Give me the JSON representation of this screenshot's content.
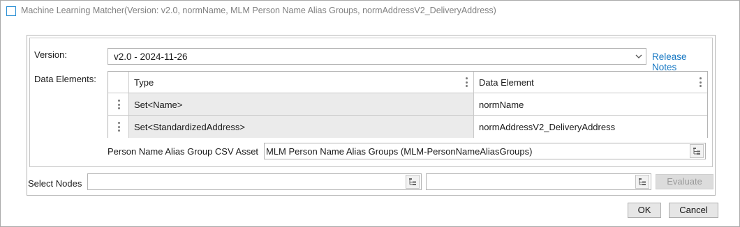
{
  "window": {
    "title": "Machine Learning Matcher(Version: v2.0, normName, MLM Person Name Alias Groups, normAddressV2_DeliveryAddress)"
  },
  "version": {
    "label": "Version:",
    "value": "v2.0 - 2024-11-26",
    "release_notes_label": "Release Notes"
  },
  "data_elements": {
    "label": "Data Elements:",
    "columns": [
      "Type",
      "Data Element"
    ],
    "rows": [
      {
        "type": "Set<Name>",
        "data_element": "normName"
      },
      {
        "type": "Set<StandardizedAddress>",
        "data_element": "normAddressV2_DeliveryAddress"
      }
    ]
  },
  "asset": {
    "label": "Person Name Alias Group CSV Asset",
    "value": "MLM Person Name Alias Groups (MLM-PersonNameAliasGroups)"
  },
  "select_nodes": {
    "label": "Select Nodes",
    "left_value": "",
    "right_value": "",
    "evaluate_label": "Evaluate"
  },
  "footer": {
    "ok_label": "OK",
    "cancel_label": "Cancel"
  },
  "colors": {
    "link": "#1577c3",
    "window_icon": "#2a8fd4",
    "selected_cell_bg": "#ebebeb",
    "disabled_button_bg": "#dcdcdc"
  },
  "icons": [
    "window-icon",
    "dropdown-arrow-icon",
    "kebab-menu-icon",
    "tree-select-icon"
  ]
}
